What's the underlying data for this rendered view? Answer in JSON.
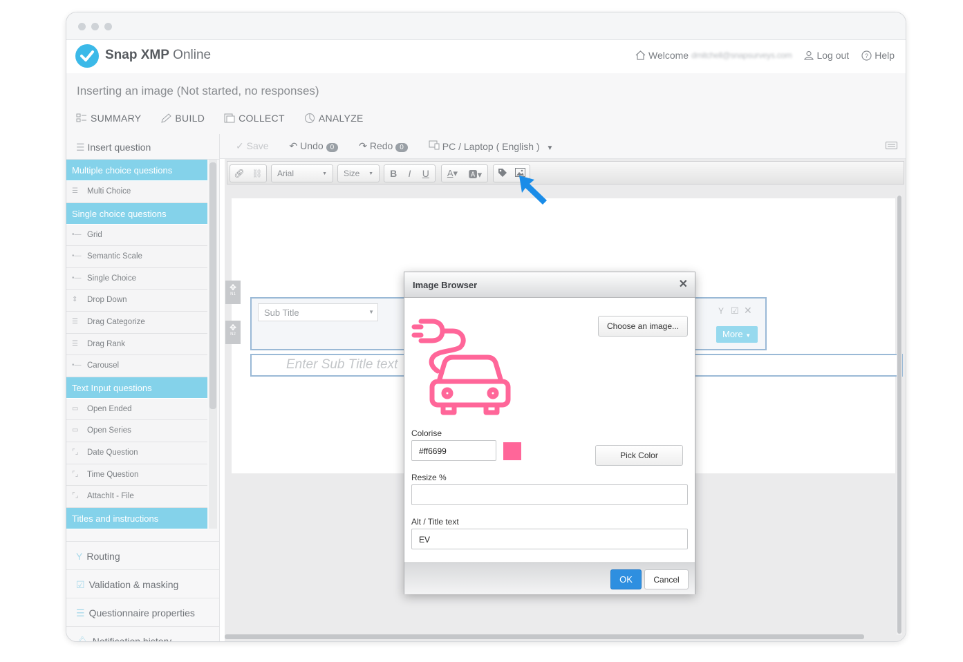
{
  "app": {
    "name_bold": "Snap XMP",
    "name_rest": " Online"
  },
  "header": {
    "welcome_label": "Welcome",
    "user_email": "dmitchell@snapsurveys.com",
    "logout_label": "Log out",
    "help_label": "Help"
  },
  "survey": {
    "title": "Inserting an image (Not started, no responses)"
  },
  "tabs": [
    {
      "label": "SUMMARY",
      "icon": "summary-icon"
    },
    {
      "label": "BUILD",
      "icon": "pencil-icon"
    },
    {
      "label": "COLLECT",
      "icon": "collect-icon"
    },
    {
      "label": "ANALYZE",
      "icon": "analyze-icon"
    }
  ],
  "actions": {
    "save": "Save",
    "undo": "Undo",
    "undo_count": "0",
    "redo": "Redo",
    "redo_count": "0",
    "device": "PC / Laptop ( English )"
  },
  "sidebar": {
    "insert_question": "Insert question",
    "categories": [
      {
        "label": "Multiple choice questions",
        "items": [
          "Multi Choice"
        ]
      },
      {
        "label": "Single choice questions",
        "items": [
          "Grid",
          "Semantic Scale",
          "Single Choice",
          "Drop Down",
          "Drag Categorize",
          "Drag Rank",
          "Carousel"
        ]
      },
      {
        "label": "Text Input questions",
        "items": [
          "Open Ended",
          "Open Series",
          "Date Question",
          "Time Question",
          "AttachIt - File"
        ]
      },
      {
        "label": "Titles and instructions",
        "items": []
      }
    ],
    "sections": [
      "Routing",
      "Validation & masking",
      "Questionnaire properties",
      "Notification history"
    ]
  },
  "toolbar": {
    "font": "Arial",
    "size": "Size",
    "bold": "B",
    "italic": "I",
    "underline": "U"
  },
  "editor": {
    "q1_style": "Sub Title",
    "q1_handle": "N1",
    "q2_handle": "N2",
    "q1_more": "More",
    "q2_placeholder": "Enter Sub Title text"
  },
  "dialog": {
    "title": "Image Browser",
    "choose_image": "Choose an image...",
    "colorise_label": "Colorise",
    "colorise_value": "#ff6699",
    "pick_color": "Pick Color",
    "resize_label": "Resize %",
    "resize_value": "",
    "alt_label": "Alt / Title text",
    "alt_value": "EV",
    "ok": "OK",
    "cancel": "Cancel",
    "image_icon": "ev-charging-car-icon",
    "colors": {
      "accent": "#ff6699",
      "ok": "#2e8fe0",
      "category": "#84d2ea",
      "logo": "#3bb9e8",
      "arrow": "#1a8ce8"
    }
  }
}
